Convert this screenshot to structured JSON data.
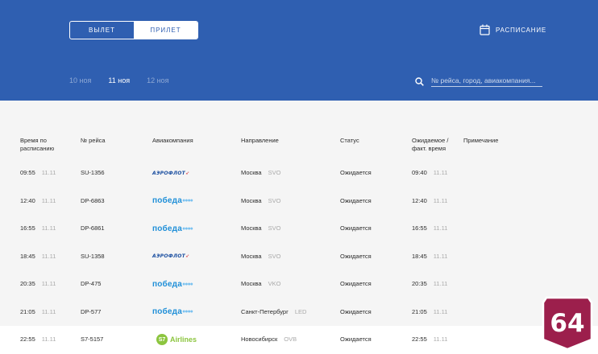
{
  "tabs": {
    "departure": "ВЫЛЕТ",
    "arrival": "ПРИЛЕТ"
  },
  "schedule_label": "РАСПИСАНИЕ",
  "dates": [
    "10 ноя",
    "11 ноя",
    "12 ноя"
  ],
  "active_date_index": 1,
  "search": {
    "placeholder": "№ рейса, город, авиакомпания..."
  },
  "columns": {
    "time": "Время по расписанию",
    "flight": "№ рейса",
    "airline": "Авиакомпания",
    "destination": "Направление",
    "status": "Статус",
    "expected": "Ожидаемое / факт. время",
    "note": "Примечание"
  },
  "rows": [
    {
      "time": "09:55",
      "date": "11.11",
      "flight": "SU-1356",
      "airline": "aeroflot",
      "city": "Москва",
      "code": "SVO",
      "status": "Ожидается",
      "exp_time": "09:40",
      "exp_date": "11.11"
    },
    {
      "time": "12:40",
      "date": "11.11",
      "flight": "DP-6863",
      "airline": "pobeda",
      "city": "Москва",
      "code": "SVO",
      "status": "Ожидается",
      "exp_time": "12:40",
      "exp_date": "11.11"
    },
    {
      "time": "16:55",
      "date": "11.11",
      "flight": "DP-6861",
      "airline": "pobeda",
      "city": "Москва",
      "code": "SVO",
      "status": "Ожидается",
      "exp_time": "16:55",
      "exp_date": "11.11"
    },
    {
      "time": "18:45",
      "date": "11.11",
      "flight": "SU-1358",
      "airline": "aeroflot",
      "city": "Москва",
      "code": "SVO",
      "status": "Ожидается",
      "exp_time": "18:45",
      "exp_date": "11.11"
    },
    {
      "time": "20:35",
      "date": "11.11",
      "flight": "DP-475",
      "airline": "pobeda",
      "city": "Москва",
      "code": "VKO",
      "status": "Ожидается",
      "exp_time": "20:35",
      "exp_date": "11.11"
    },
    {
      "time": "21:05",
      "date": "11.11",
      "flight": "DP-577",
      "airline": "pobeda",
      "city": "Санкт-Петербург",
      "code": "LED",
      "status": "Ожидается",
      "exp_time": "21:05",
      "exp_date": "11.11"
    },
    {
      "time": "22:55",
      "date": "11.11",
      "flight": "S7-5157",
      "airline": "s7",
      "city": "Новосибирск",
      "code": "OVB",
      "status": "Ожидается",
      "exp_time": "22:55",
      "exp_date": "11.11"
    }
  ],
  "logos": {
    "aeroflot": "АЭРОФЛОТ",
    "pobeda": "победа",
    "s7": "S7 Airlines",
    "s7_mark": "S7",
    "s7_word": "Airlines"
  },
  "badge": {
    "text": "64",
    "color": "#9c1f4c"
  },
  "colors": {
    "header": "#2f5fb1",
    "highlight_row": "#ffffff"
  }
}
